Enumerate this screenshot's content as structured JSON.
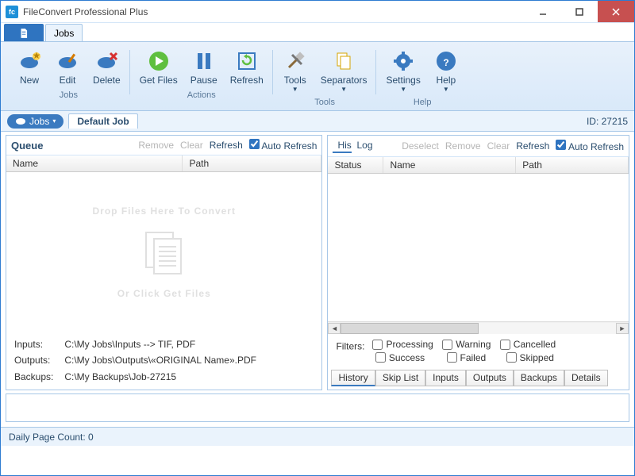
{
  "title": "FileConvert Professional Plus",
  "tabs": {
    "main": "Jobs"
  },
  "ribbon": {
    "jobs": {
      "label": "Jobs",
      "new": "New",
      "edit": "Edit",
      "delete": "Delete"
    },
    "actions": {
      "label": "Actions",
      "getfiles": "Get Files",
      "pause": "Pause",
      "refresh": "Refresh"
    },
    "tools": {
      "label": "Tools",
      "tools": "Tools",
      "separators": "Separators"
    },
    "help": {
      "label": "Help",
      "settings": "Settings",
      "help": "Help"
    }
  },
  "subtabs": {
    "jobs": "Jobs",
    "default": "Default Job",
    "id_label": "ID:",
    "id_value": "27215"
  },
  "queue": {
    "title": "Queue",
    "actions": {
      "remove": "Remove",
      "clear": "Clear",
      "refresh": "Refresh",
      "auto": "Auto Refresh"
    },
    "cols": {
      "name": "Name",
      "path": "Path"
    },
    "drop1": "Drop Files Here To Convert",
    "drop2": "Or Click Get Files",
    "paths": {
      "inputs_lbl": "Inputs:",
      "inputs": "C:\\My Jobs\\Inputs  --> TIF, PDF",
      "outputs_lbl": "Outputs:",
      "outputs": "C:\\My Jobs\\Outputs\\«ORIGINAL Name».PDF",
      "backups_lbl": "Backups:",
      "backups": "C:\\My Backups\\Job-27215"
    }
  },
  "history": {
    "tabs": {
      "history": "History",
      "log": "Log"
    },
    "actions": {
      "deselect": "Deselect",
      "remove": "Remove",
      "clear": "Clear",
      "refresh": "Refresh",
      "auto": "Auto Refresh"
    },
    "cols": {
      "status": "Status",
      "name": "Name",
      "path": "Path"
    },
    "filters_lbl": "Filters:",
    "filters": {
      "processing": "Processing",
      "warning": "Warning",
      "cancelled": "Cancelled",
      "success": "Success",
      "failed": "Failed",
      "skipped": "Skipped"
    },
    "bottom_tabs": {
      "history": "History",
      "skiplist": "Skip List",
      "inputs": "Inputs",
      "outputs": "Outputs",
      "backups": "Backups",
      "details": "Details"
    }
  },
  "status": {
    "pages": "Daily Page Count: 0"
  }
}
